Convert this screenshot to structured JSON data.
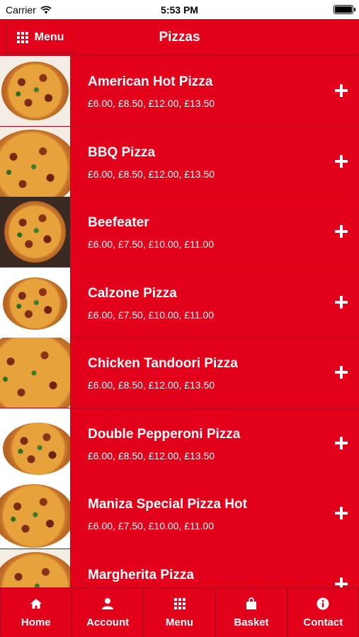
{
  "status_bar": {
    "carrier": "Carrier",
    "time": "5:53 PM",
    "battery_level": 1.0
  },
  "header": {
    "menu_label": "Menu",
    "title": "Pizzas"
  },
  "colors": {
    "brand_red": "#e3001b",
    "text": "#ffffff"
  },
  "items": [
    {
      "name": "American Hot Pizza",
      "prices": "£6.00, £8.50, £12.00, £13.50"
    },
    {
      "name": "BBQ Pizza",
      "prices": "£6.00, £8.50, £12.00, £13.50"
    },
    {
      "name": "Beefeater",
      "prices": "£6.00, £7.50, £10.00, £11.00"
    },
    {
      "name": "Calzone Pizza",
      "prices": "£6.00, £7.50, £10.00, £11.00"
    },
    {
      "name": "Chicken Tandoori Pizza",
      "prices": "£6.00, £8.50, £12.00, £13.50"
    },
    {
      "name": "Double Pepperoni Pizza",
      "prices": "£6.00, £8.50, £12.00, £13.50"
    },
    {
      "name": "Maniza Special Pizza Hot",
      "prices": "£6.00, £7.50, £10.00, £11.00"
    },
    {
      "name": "Margherita Pizza",
      "prices": ""
    }
  ],
  "tabs": [
    {
      "label": "Home",
      "icon": "home-icon"
    },
    {
      "label": "Account",
      "icon": "user-icon"
    },
    {
      "label": "Menu",
      "icon": "grid-icon"
    },
    {
      "label": "Basket",
      "icon": "bag-icon"
    },
    {
      "label": "Contact",
      "icon": "info-icon"
    }
  ]
}
